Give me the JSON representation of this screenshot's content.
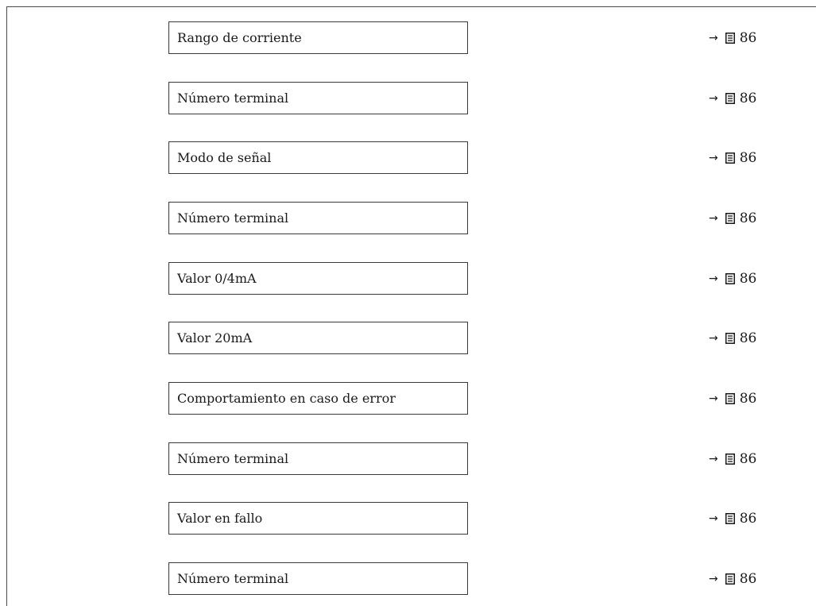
{
  "parameters": [
    {
      "label": "Rango de corriente",
      "ref_arrow": "→",
      "ref_page": "86"
    },
    {
      "label": "Número terminal",
      "ref_arrow": "→",
      "ref_page": "86"
    },
    {
      "label": "Modo de señal",
      "ref_arrow": "→",
      "ref_page": "86"
    },
    {
      "label": "Número terminal",
      "ref_arrow": "→",
      "ref_page": "86"
    },
    {
      "label": "Valor 0/4mA",
      "ref_arrow": "→",
      "ref_page": "86"
    },
    {
      "label": "Valor 20mA",
      "ref_arrow": "→",
      "ref_page": "86"
    },
    {
      "label": "Comportamiento en caso de error",
      "ref_arrow": "→",
      "ref_page": "86"
    },
    {
      "label": "Número terminal",
      "ref_arrow": "→",
      "ref_page": "86"
    },
    {
      "label": "Valor en fallo",
      "ref_arrow": "→",
      "ref_page": "86"
    },
    {
      "label": "Número terminal",
      "ref_arrow": "→",
      "ref_page": "86"
    }
  ],
  "icons": {
    "page_reference": "page-document-icon"
  }
}
